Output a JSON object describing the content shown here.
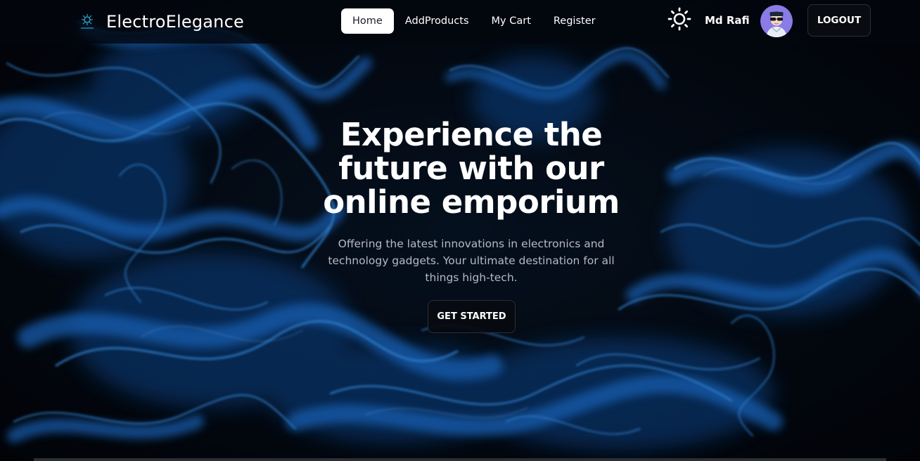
{
  "brand": {
    "name": "ElectroElegance",
    "logo_icon": "circuit-logo-icon"
  },
  "nav": {
    "links": [
      {
        "label": "Home",
        "active": true
      },
      {
        "label": "AddProducts",
        "active": false
      },
      {
        "label": "My Cart",
        "active": false
      },
      {
        "label": "Register",
        "active": false
      }
    ]
  },
  "user": {
    "name": "Md Rafi",
    "theme_icon": "sun-icon",
    "avatar_icon": "user-avatar-icon",
    "logout_label": "LOGOUT"
  },
  "hero": {
    "title": "Experience the future with our online emporium",
    "subtitle": "Offering the latest innovations in electronics and technology gadgets. Your ultimate destination for all things high-tech.",
    "cta_label": "GET STARTED"
  },
  "colors": {
    "background": "#04070d",
    "smoke": "#1f7fe0",
    "active_nav_bg": "#ffffff",
    "text": "#ffffff",
    "subtitle": "#b4bac3"
  }
}
